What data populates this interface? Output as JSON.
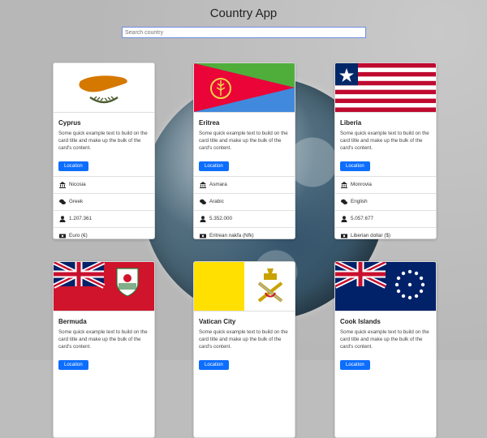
{
  "app": {
    "title": "Country App",
    "search": {
      "placeholder": "Search country",
      "value": ""
    }
  },
  "cards": [
    {
      "name": "Cyprus",
      "text": "Some quick example text to build on the card title and make up the bulk of the card's content.",
      "button": "Location",
      "capital": "Nicosia",
      "language": "Greek",
      "population": "1.207.361",
      "currency": "Euro (€)"
    },
    {
      "name": "Eritrea",
      "text": "Some quick example text to build on the card title and make up the bulk of the card's content.",
      "button": "Location",
      "capital": "Asmara",
      "language": "Arabic",
      "population": "5.352.000",
      "currency": "Eritrean nakfa (Nfk)"
    },
    {
      "name": "Liberia",
      "text": "Some quick example text to build on the card title and make up the bulk of the card's content.",
      "button": "Location",
      "capital": "Monrovia",
      "language": "English",
      "population": "5.057.677",
      "currency": "Liberian dollar ($)"
    },
    {
      "name": "Bermuda",
      "text": "Some quick example text to build on the card title and make up the bulk of the card's content.",
      "button": "Location"
    },
    {
      "name": "Vatican City",
      "text": "Some quick example text to build on the card title and make up the bulk of the card's content.",
      "button": "Location"
    },
    {
      "name": "Cook Islands",
      "text": "Some quick example text to build on the card title and make up the bulk of the card's content.",
      "button": "Location"
    }
  ],
  "icons": {
    "capital": "bank-icon",
    "language": "speech-bubbles-icon",
    "population": "person-icon",
    "currency": "money-icon"
  },
  "colors": {
    "accent": "#0d6efd",
    "search_border": "#6f8fe6"
  }
}
